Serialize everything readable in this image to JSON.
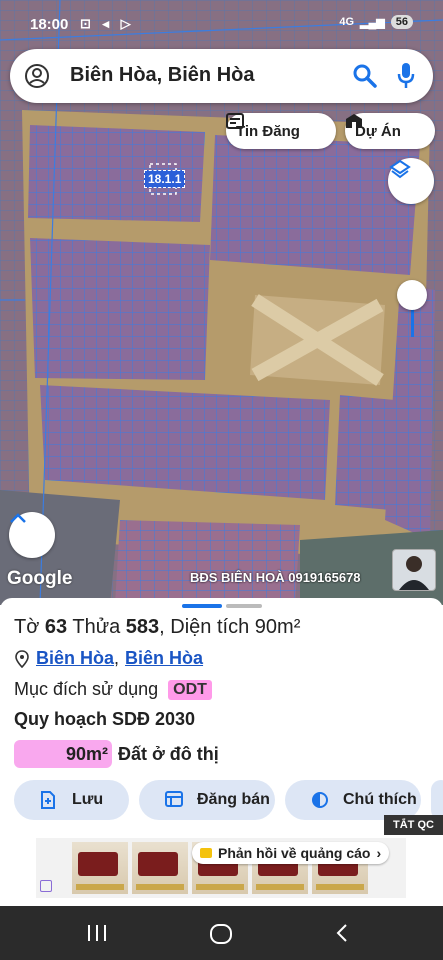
{
  "status_bar": {
    "time": "18:00",
    "network": "4G",
    "battery": "56"
  },
  "search": {
    "query": "Biên Hòa, Biên Hòa"
  },
  "map": {
    "chip_tin_dang": "Tin Đăng",
    "chip_du_an": "Dự Án",
    "plot_label": "18.1.1",
    "google_logo": "Google",
    "watermark": "BĐS BIÊN HOÀ 0919165678"
  },
  "parcel": {
    "sheet_label": "Tờ",
    "sheet_no": "63",
    "plot_label": "Thửa",
    "plot_no": "583",
    "area_label": "Diện tích",
    "area_value": "90m²",
    "location_1": "Biên Hòa",
    "location_2": "Biên Hòa",
    "purpose_label": "Mục đích sử dụng",
    "purpose_code": "ODT",
    "plan_title": "Quy hoạch SDĐ 2030",
    "plan_area": "90m²",
    "plan_area_label": "Đất ở đô thị"
  },
  "actions": {
    "save": "Lưu",
    "post": "Đăng bán",
    "legend": "Chú thích"
  },
  "ads": {
    "close_ads": "TẮT QC",
    "feedback": "Phản hồi về quảng cáo"
  },
  "colors": {
    "accent": "#1a73e8",
    "odt": "#ff9ae9",
    "road": "#b49a6a",
    "parcel": "#8b6c9c"
  }
}
